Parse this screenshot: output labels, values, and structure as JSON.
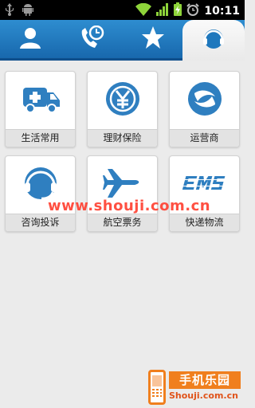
{
  "status_bar": {
    "time": "10:11"
  },
  "tabs": [
    {
      "name": "contacts",
      "icon": "person-icon",
      "active": false
    },
    {
      "name": "recent-calls",
      "icon": "phone-clock-icon",
      "active": false
    },
    {
      "name": "favorites",
      "icon": "star-icon",
      "active": false
    },
    {
      "name": "services",
      "icon": "headset-icon",
      "active": true
    }
  ],
  "tiles": [
    {
      "label": "生活常用",
      "icon": "ambulance-icon"
    },
    {
      "label": "理财保险",
      "icon": "yuan-coin-icon"
    },
    {
      "label": "运营商",
      "icon": "china-mobile-icon"
    },
    {
      "label": "咨询投诉",
      "icon": "headset-icon"
    },
    {
      "label": "航空票务",
      "icon": "airplane-icon"
    },
    {
      "label": "快递物流",
      "icon": "ems-icon"
    }
  ],
  "watermark": "www.shouji.com.cn",
  "logo": {
    "title": "手机乐园",
    "subtitle": "Shouji.com.cn"
  },
  "colors": {
    "accent": "#1b73b8",
    "icon_blue": "#2f7fc0",
    "tabbar": "#1868ad"
  }
}
